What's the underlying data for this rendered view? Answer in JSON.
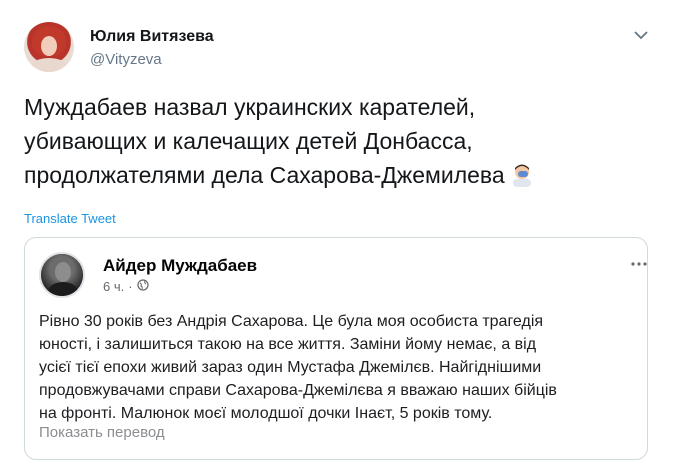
{
  "tweet": {
    "author_name": "Юлия Витязева",
    "author_handle": "@Vityzeva",
    "text_lines": [
      "Муждабаев назвал украинских карателей,",
      "убивающих и калечащих детей Донбасса,",
      "продолжателями дела Сахарова-Джемилева"
    ],
    "emoji": "man-facepalming",
    "translate_label": "Translate Tweet"
  },
  "quote": {
    "author_name": "Айдер Муждабаев",
    "time": "6 ч.",
    "separator": "·",
    "audience_icon": "globe-icon",
    "text_lines": [
      "Рівно 30 років без Андрія Сахарова. Це була моя особиста трагедія",
      "юності, і залишиться такою на все життя. Заміни йому немає, а від",
      "усієї тієї епохи живий зараз один Мустафа Джемілєв. Найгіднішими",
      "продовжувачами справи Сахарова-Джемілєва я вважаю наших бійців",
      "на фронті. Малюнок моєї молодшої дочки Інаєт, 5 років тому."
    ],
    "translate_label": "Показать перевод"
  },
  "colors": {
    "link_blue": "#1b95e0",
    "secondary_gray": "#657786",
    "border": "#cfd9de"
  }
}
